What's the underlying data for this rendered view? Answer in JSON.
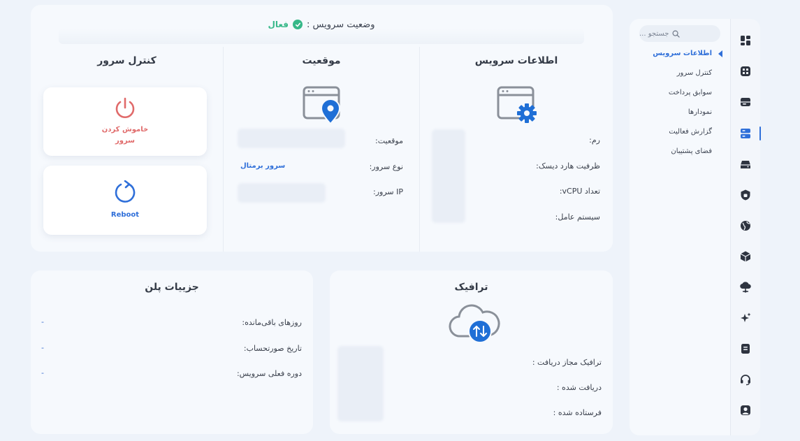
{
  "status": {
    "label": "وضعیت سرویس :",
    "value": "فعال"
  },
  "service_info": {
    "title": "اطلاعات سرویس",
    "fields": [
      {
        "label": "رم:"
      },
      {
        "label": "ظرفیت هارد دیسک:"
      },
      {
        "label": "تعداد vCPU:"
      },
      {
        "label": "سیستم عامل:"
      }
    ]
  },
  "location": {
    "title": "موقعیت",
    "fields": [
      {
        "label": "موقعیت:",
        "value": ""
      },
      {
        "label": "نوع سرور:",
        "value": "سرور برمتال"
      },
      {
        "label": "IP سرور:",
        "value": ""
      }
    ]
  },
  "server_control": {
    "title": "کنترل سرور",
    "power_label": "خاموش کردن سرور",
    "reboot_label": "Reboot"
  },
  "plan": {
    "title": "جزییات پلن",
    "fields": [
      {
        "label": "روزهای باقی‌مانده:",
        "value": "-"
      },
      {
        "label": "تاریخ صورتحساب:",
        "value": "-"
      },
      {
        "label": "دوره فعلی سرویس:",
        "value": "-"
      }
    ]
  },
  "traffic": {
    "title": "ترافیک",
    "fields": [
      {
        "label": "ترافیک مجاز دریافت :"
      },
      {
        "label": "دریافت شده :"
      },
      {
        "label": "فرستاده شده :"
      }
    ]
  },
  "sidebar": {
    "search_placeholder": "جستجو ...",
    "items": [
      {
        "label": "اطلاعات سرویس",
        "active": true
      },
      {
        "label": "کنترل سرور"
      },
      {
        "label": "سوابق پرداخت"
      },
      {
        "label": "نمودارها"
      },
      {
        "label": "گزارش فعالیت"
      },
      {
        "label": "فضای پشتیبان"
      }
    ]
  },
  "icon_rail": [
    "dashboard-icon",
    "apps-icon",
    "storage-icon",
    "server-icon",
    "cloud-drive-icon",
    "security-icon",
    "globe-icon",
    "box-icon",
    "cloud-network-icon",
    "sparkle-icon",
    "document-icon",
    "headset-icon",
    "profile-icon"
  ],
  "colors": {
    "accent": "#2f6fd9",
    "success": "#37b889",
    "danger": "#e06a6a",
    "icon_dark": "#2e3440"
  }
}
